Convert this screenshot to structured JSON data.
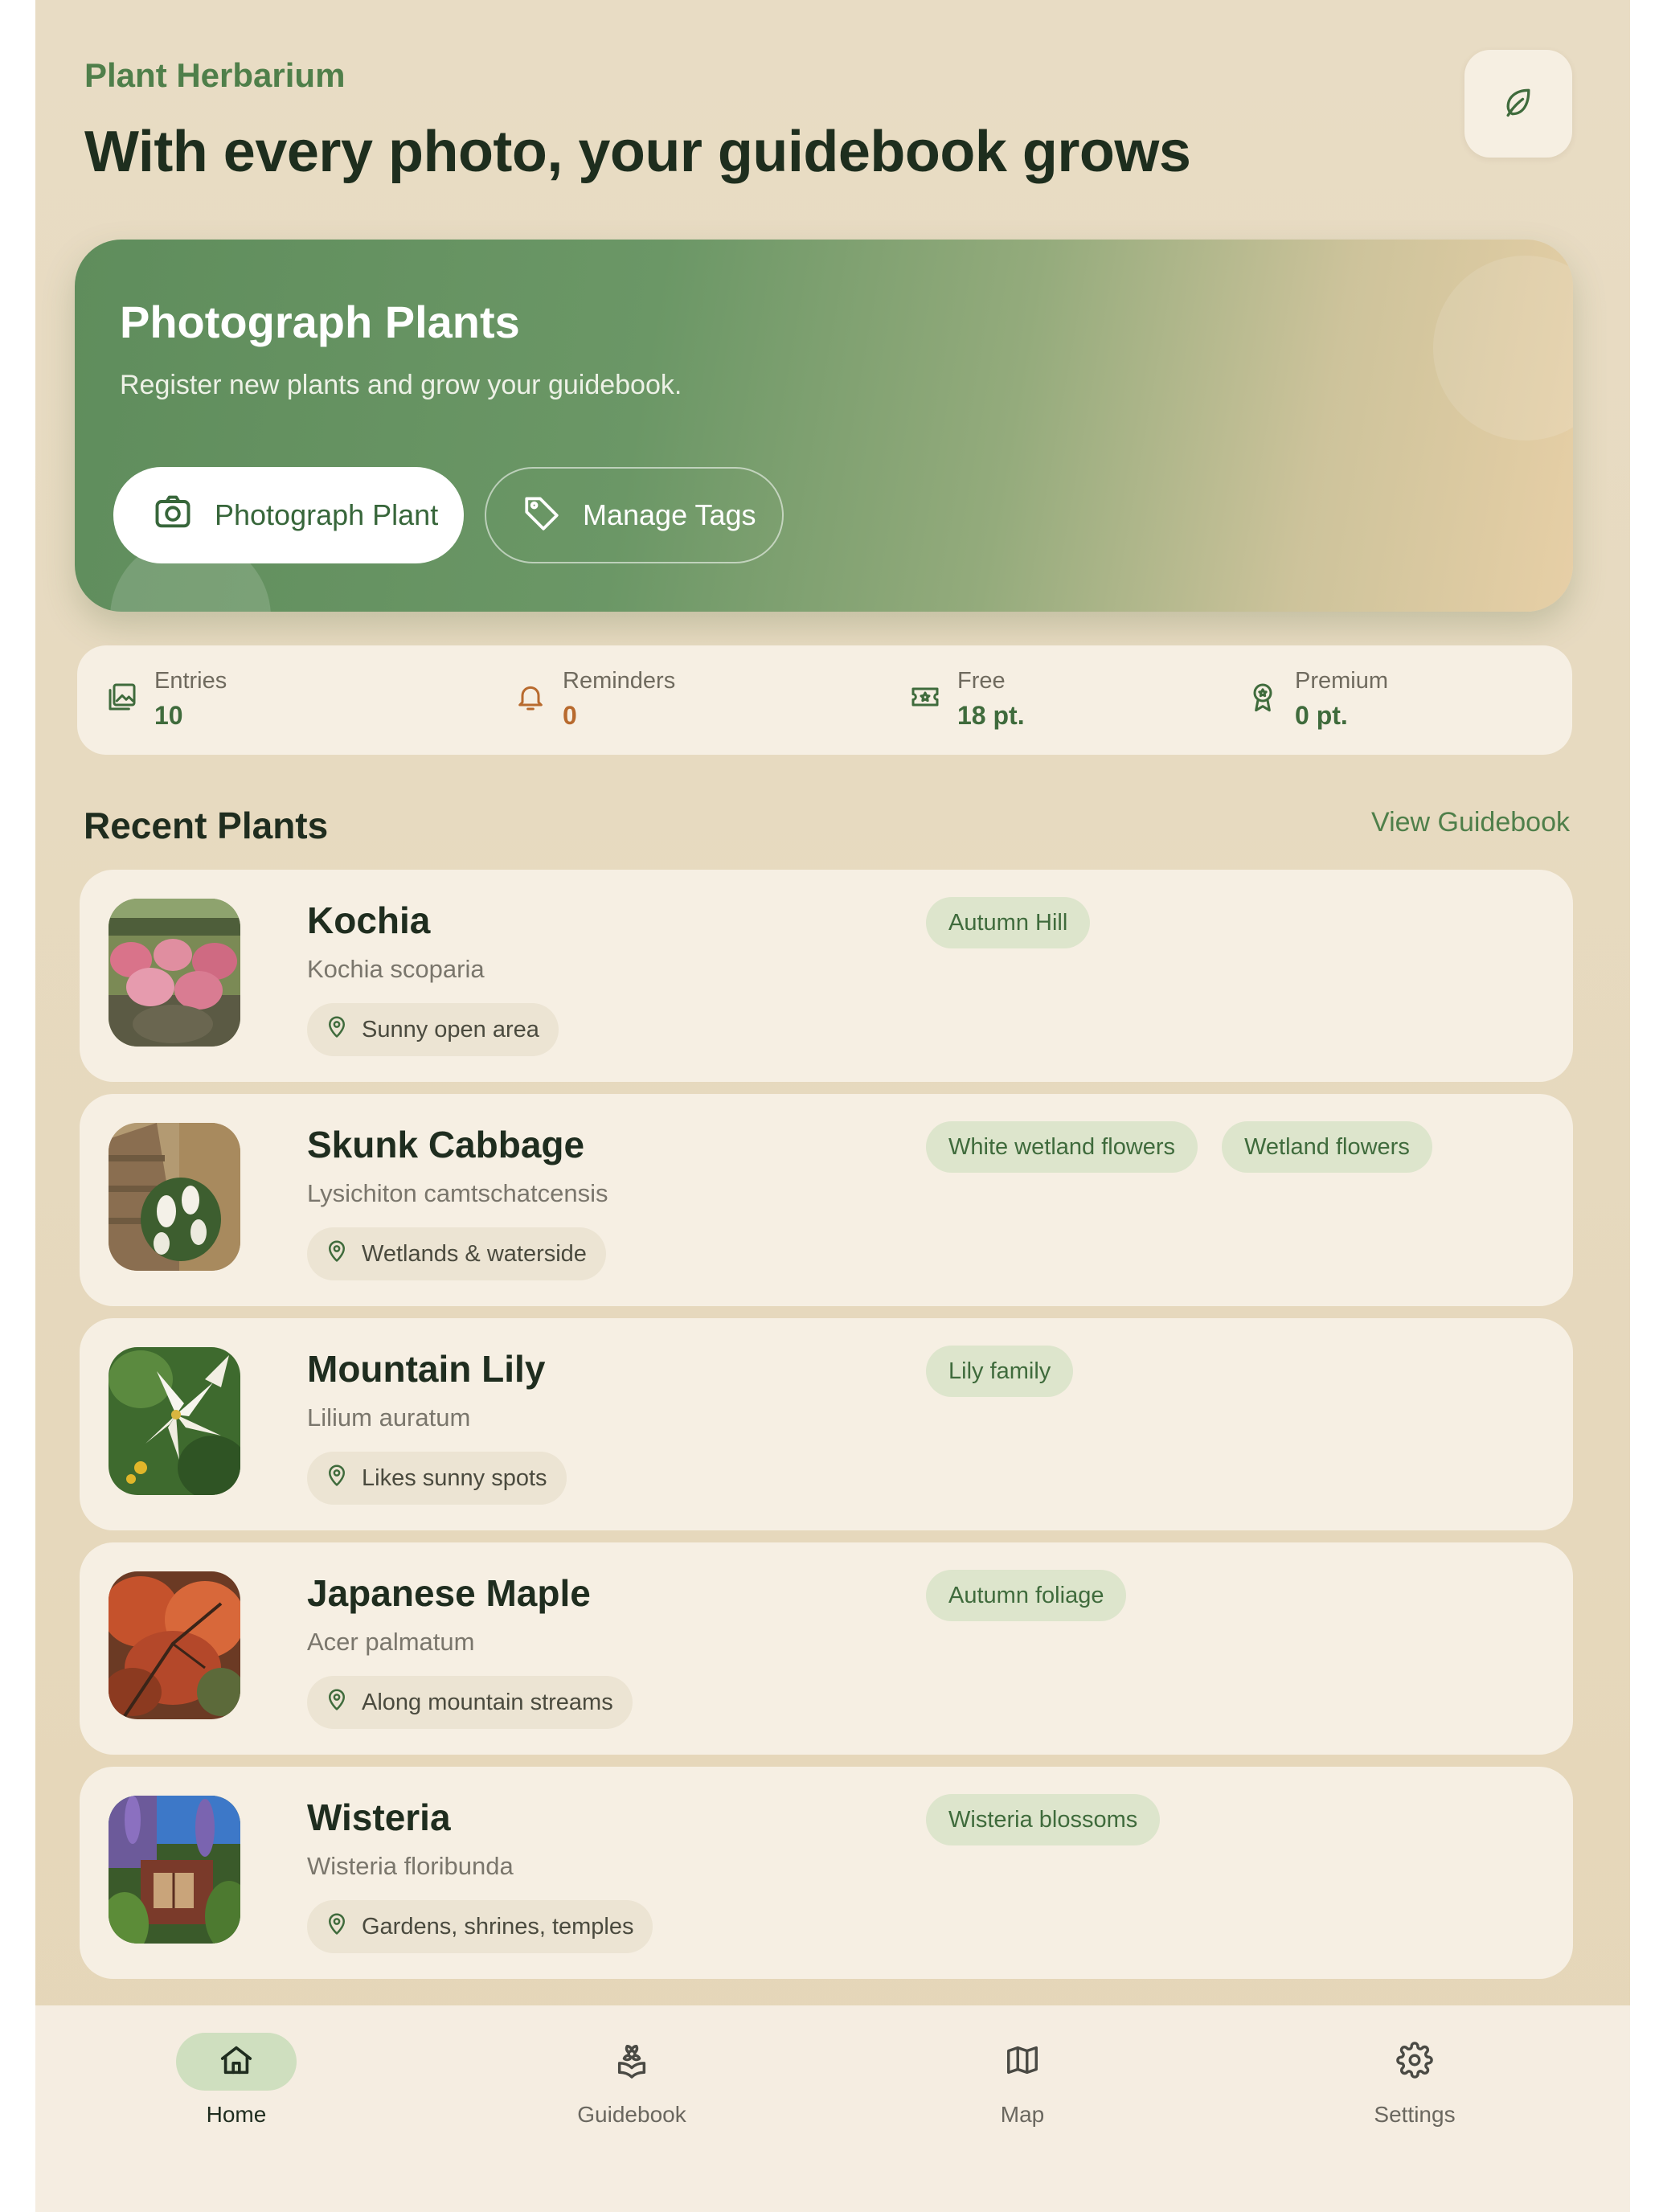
{
  "header": {
    "app_label": "Plant Herbarium",
    "headline": "With every photo, your guidebook grows",
    "leaf_icon": "leaf-icon"
  },
  "hero": {
    "title": "Photograph Plants",
    "subtitle": "Register new plants and grow your guidebook.",
    "primary_button": "Photograph Plant",
    "secondary_button": "Manage Tags"
  },
  "stats": [
    {
      "label": "Entries",
      "value": "10",
      "icon": "photo-stack-icon",
      "color": "#3f6b3c"
    },
    {
      "label": "Reminders",
      "value": "0",
      "icon": "bell-icon",
      "color": "#b86a2e"
    },
    {
      "label": "Free",
      "value": "18 pt.",
      "icon": "ticket-star-icon",
      "color": "#3f6b3c"
    },
    {
      "label": "Premium",
      "value": "0 pt.",
      "icon": "award-icon",
      "color": "#3f6b3c"
    }
  ],
  "recent": {
    "title": "Recent Plants",
    "view_all": "View Guidebook",
    "items": [
      {
        "name": "Kochia",
        "scientific": "Kochia scoparia",
        "location": "Sunny open area",
        "tags": [
          "Autumn Hill"
        ]
      },
      {
        "name": "Skunk Cabbage",
        "scientific": "Lysichiton camtschatcensis",
        "location": "Wetlands & waterside",
        "tags": [
          "White wetland flowers",
          "Wetland flowers"
        ]
      },
      {
        "name": "Mountain Lily",
        "scientific": "Lilium auratum",
        "location": "Likes sunny spots",
        "tags": [
          "Lily family"
        ]
      },
      {
        "name": "Japanese Maple",
        "scientific": "Acer palmatum",
        "location": "Along mountain streams",
        "tags": [
          "Autumn foliage"
        ]
      },
      {
        "name": "Wisteria",
        "scientific": "Wisteria floribunda",
        "location": "Gardens, shrines, temples",
        "tags": [
          "Wisteria blossoms"
        ]
      }
    ]
  },
  "nav": [
    {
      "label": "Home",
      "icon": "home-icon",
      "active": true
    },
    {
      "label": "Guidebook",
      "icon": "flower-book-icon",
      "active": false
    },
    {
      "label": "Map",
      "icon": "map-icon",
      "active": false
    },
    {
      "label": "Settings",
      "icon": "gear-icon",
      "active": false
    }
  ],
  "colors": {
    "accent": "#4f7f4a",
    "background": "#e8dcc4",
    "card": "#f6efe3",
    "tag": "#dde5cc",
    "warning": "#b86a2e"
  }
}
